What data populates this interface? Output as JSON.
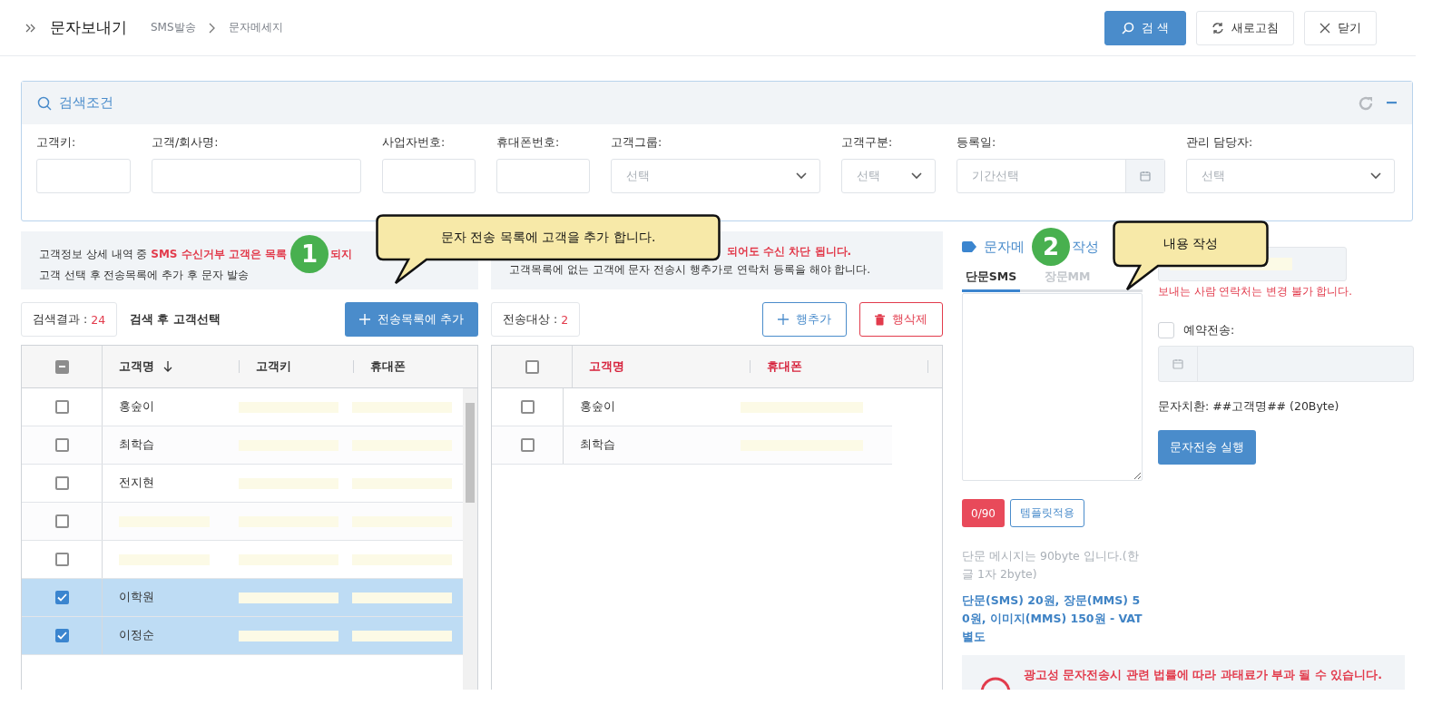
{
  "header": {
    "title": "문자보내기",
    "breadcrumb": [
      "SMS발송",
      "문자메세지"
    ],
    "buttons": [
      {
        "kind": "search",
        "label": "검 색"
      },
      {
        "kind": "refresh",
        "label": "새로고침"
      },
      {
        "kind": "close",
        "label": "닫기"
      }
    ]
  },
  "search_panel": {
    "title": "검색조건",
    "fields": [
      {
        "label": "고객키:",
        "kind": "text"
      },
      {
        "label": "고객/회사명:",
        "kind": "text"
      },
      {
        "label": "사업자번호:",
        "kind": "text"
      },
      {
        "label": "휴대폰번호:",
        "kind": "text"
      },
      {
        "label": "고객그룹:",
        "kind": "select",
        "placeholder": "선택"
      },
      {
        "label": "고객구분:",
        "kind": "select",
        "placeholder": "선택"
      },
      {
        "label": "등록일:",
        "kind": "date",
        "placeholder": "기간선택"
      },
      {
        "label": "관리 담당자:",
        "kind": "select",
        "placeholder": "선택"
      }
    ]
  },
  "left_notice": {
    "line1": "고객정보 상세 내역 중 **SMS 수신거부 고객은 목록**",
    "line1_tail": "되지",
    "line2": "고객 선택 후 전송목록에 추가 후 문자 발송"
  },
  "middle_notice": {
    "line1": "되어도 수신 차단 됩니다.",
    "line2": "고객목록에 없는 고객에 문자 전송시 행추가로 연락처 등록을 해야 합니다."
  },
  "left_table": {
    "result_label": "검색결과 :",
    "result_count": "24",
    "hint": "검색 후 고객선택",
    "add_button": "전송목록에 추가",
    "header_checkbox": {
      "indeterminate": true
    },
    "columns": [
      {
        "label": "고객명",
        "sorted_descending": true
      },
      {
        "label": "고객키"
      },
      {
        "label": "휴대폰"
      }
    ],
    "rows": [
      {
        "name": "홍숲이",
        "selected": false
      },
      {
        "name": "최학습",
        "selected": false
      },
      {
        "name": "전지현",
        "selected": false
      },
      {
        "selected": false
      },
      {
        "selected": false
      },
      {
        "name": "이학원",
        "selected": true
      },
      {
        "name": "이정순",
        "selected": true
      }
    ]
  },
  "right_table": {
    "count_label": "전송대상 :",
    "count": "2",
    "buttons": [
      {
        "kind": "add",
        "label": "행추가"
      },
      {
        "kind": "delete",
        "label": "행삭제"
      }
    ],
    "header_checkbox": {
      "checked": false,
      "indeterminate": false
    },
    "columns": [
      {
        "label": "고객명"
      },
      {
        "label": "휴대폰"
      }
    ],
    "rows": [
      {
        "name": "홍숲이",
        "selected": false
      },
      {
        "name": "최학습",
        "selected": false
      }
    ]
  },
  "compose": {
    "title_start": "문자메",
    "title_end": "작성",
    "tabs": [
      {
        "label": "단문SMS",
        "selected": true
      },
      {
        "label": "장문MM",
        "selected": false
      }
    ],
    "sender_note": "보내는 사람 연락처는 변경 불가 합니다.",
    "reserve": {
      "label": "예약전송:",
      "checked": false
    },
    "substitution": "문자치환: ##고객명## (20Byte)",
    "send_button": "문자전송 실행",
    "counter": "0/90",
    "template_button": "템플릿적용",
    "help": "단문 메시지는 90byte 입니다.(한글 1자 2byte)",
    "pricing": "단문(SMS) 20원, 장문(MMS) 50원, 이미지(MMS) 150원 - VAT별도",
    "warning": "광고성 문자전송시 관련 법률에 따라 과태료가 부과 될 수 있습니다."
  },
  "callouts": [
    {
      "number": "1",
      "text": "문자 전송 목록에 고객을 추가 합니다."
    },
    {
      "number": "2",
      "text": "내용 작성"
    }
  ]
}
